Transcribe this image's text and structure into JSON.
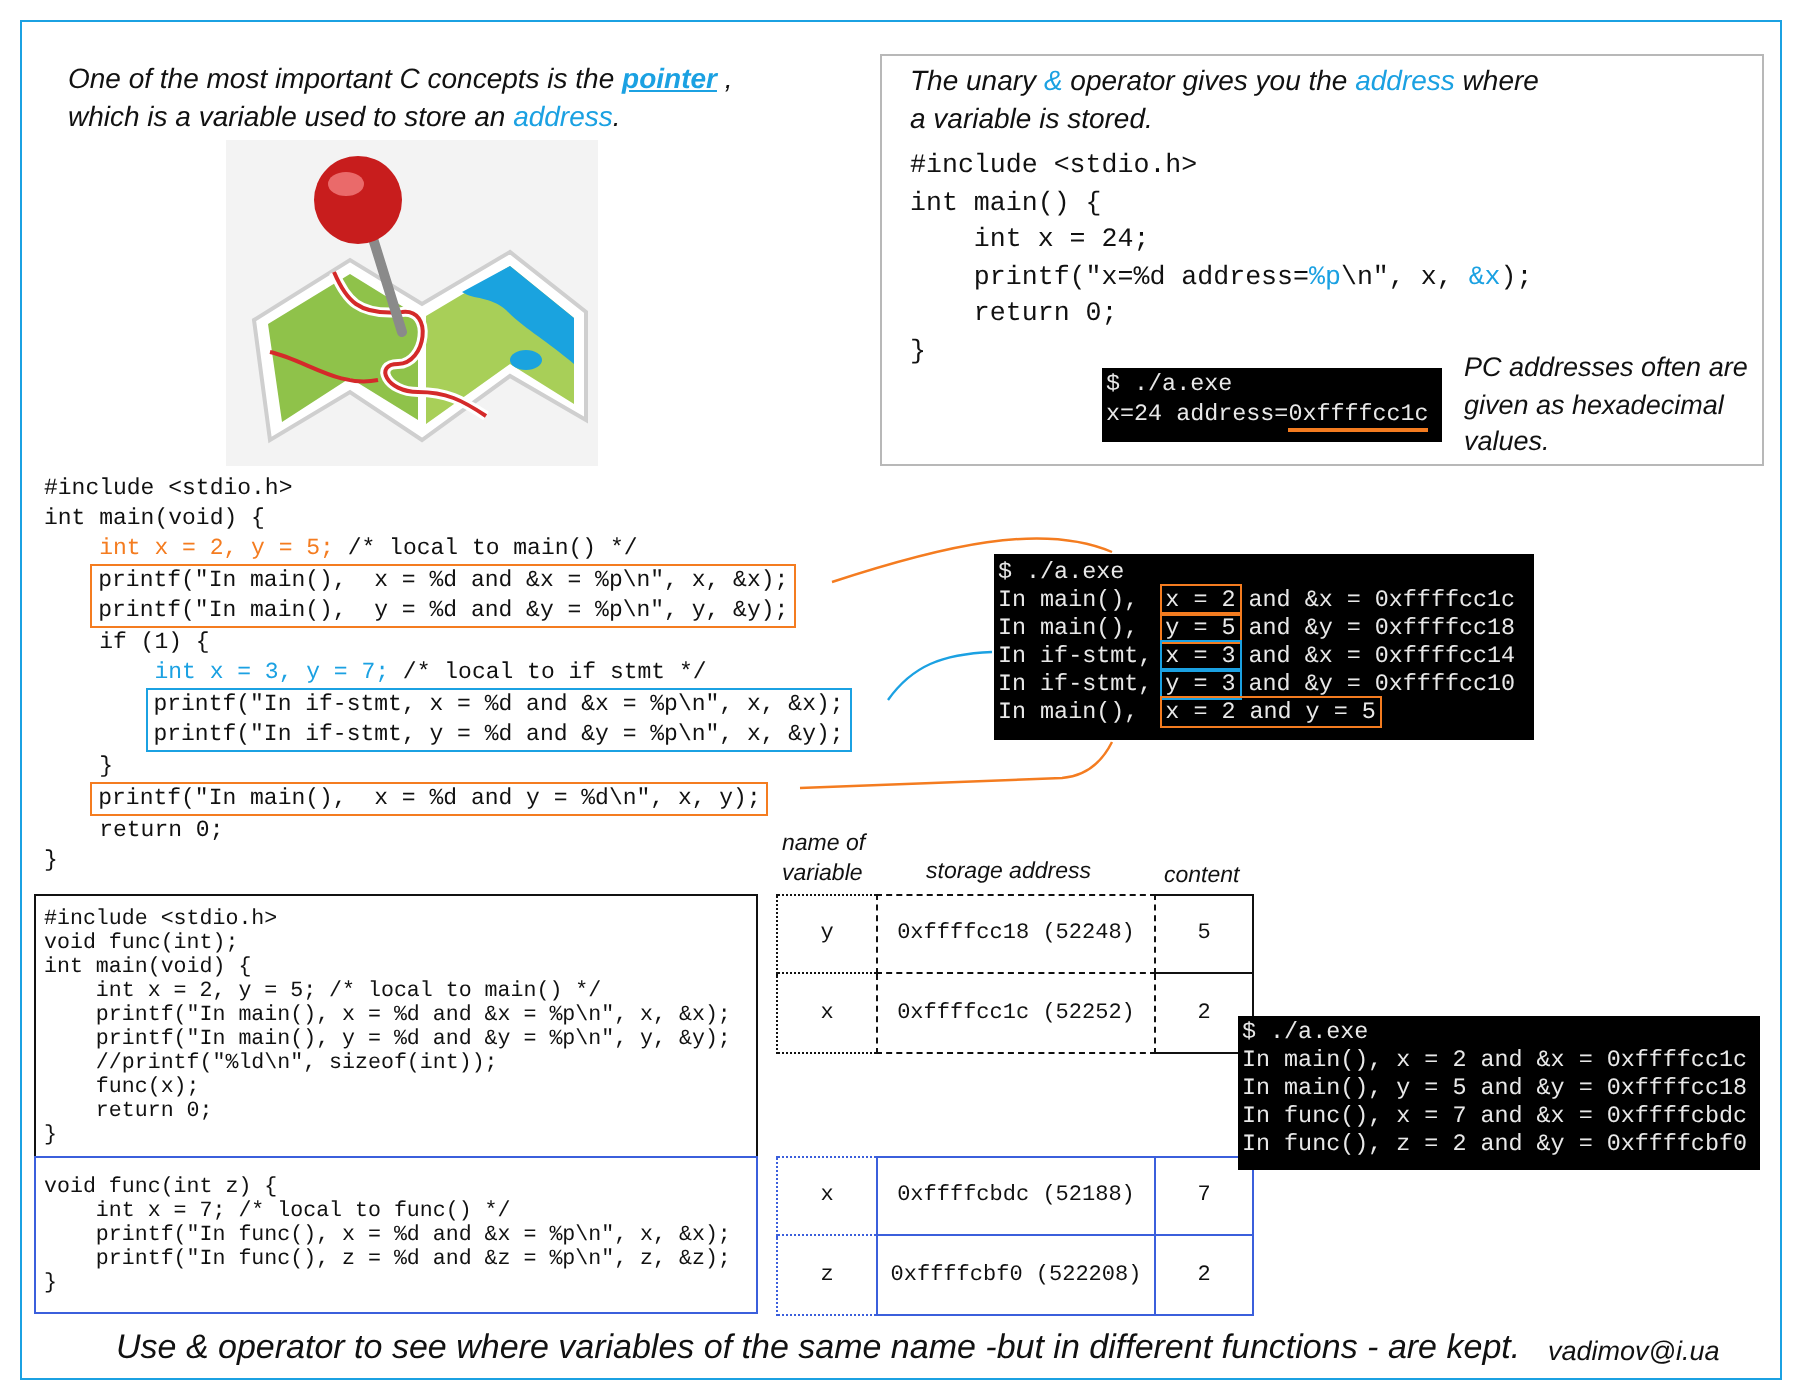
{
  "intro": {
    "segments": [
      {
        "text": "One of the most important C concepts is the ",
        "kind": "plain"
      },
      {
        "text": "pointer",
        "kind": "link"
      },
      {
        "text": " ,\nwhich is a variable used to store an ",
        "kind": "plain"
      },
      {
        "text": "address",
        "kind": "accent"
      },
      {
        "text": ".",
        "kind": "plain"
      }
    ]
  },
  "info": {
    "segments": [
      {
        "text": "The unary ",
        "kind": "plain"
      },
      {
        "text": "&",
        "kind": "accent"
      },
      {
        "text": " operator gives you the ",
        "kind": "plain"
      },
      {
        "text": "address",
        "kind": "accent"
      },
      {
        "text": " where\na variable is stored.",
        "kind": "plain"
      }
    ],
    "code": [
      "#include <stdio.h>",
      "int main() {",
      "    int x = 24;",
      {
        "segments": [
          {
            "text": "    printf(\"x=%d address=",
            "kind": "plain"
          },
          {
            "text": "%p",
            "kind": "accent"
          },
          {
            "text": "\\n\", x, ",
            "kind": "plain"
          },
          {
            "text": "&x",
            "kind": "accent"
          },
          {
            "text": ");",
            "kind": "plain"
          }
        ]
      },
      "    return 0;",
      "}"
    ],
    "terminal": [
      "$ ./a.exe",
      {
        "segments": [
          {
            "text": "x=24 address=",
            "kind": "plain"
          },
          {
            "text": "0xffffcc1c",
            "kind": "underline"
          }
        ]
      }
    ],
    "note": "PC addresses often are given as hexadecimal values."
  },
  "scope_demo": {
    "code_blocks": [
      {
        "kind": "plain",
        "lines": [
          "#include <stdio.h>",
          "int main(void) {",
          {
            "segments": [
              {
                "text": "    int x = 2, y = 5;",
                "kind": "warm"
              },
              {
                "text": " /* local to main() */",
                "kind": "plain"
              }
            ]
          }
        ]
      },
      {
        "kind": "framed",
        "color": "#f47c20",
        "lines": [
          "    printf(\"In main(),  x = %d and &x = %p\\n\", x, &x);",
          "    printf(\"In main(),  y = %d and &y = %p\\n\", y, &y);"
        ]
      },
      {
        "kind": "plain",
        "lines": [
          "    if (1) {",
          {
            "segments": [
              {
                "text": "        int x = 3, y = 7;",
                "kind": "accent"
              },
              {
                "text": " /* local to if stmt */",
                "kind": "plain"
              }
            ]
          }
        ]
      },
      {
        "kind": "framed",
        "color": "#1ba1e2",
        "lines": [
          "        printf(\"In if-stmt, x = %d and &x = %p\\n\", x, &x);",
          "        printf(\"In if-stmt, y = %d and &y = %p\\n\", x, &y);"
        ]
      },
      {
        "kind": "plain",
        "lines": [
          "    }"
        ]
      },
      {
        "kind": "framed",
        "color": "#f47c20",
        "lines": [
          "    printf(\"In main(),  x = %d and y = %d\\n\", x, y);"
        ]
      },
      {
        "kind": "plain",
        "lines": [
          "    return 0;",
          "}"
        ]
      }
    ],
    "terminal": [
      "$ ./a.exe",
      {
        "segments": [
          {
            "text": "In main(),  ",
            "kind": "plain"
          },
          {
            "text": "x = 2",
            "kind": "frame",
            "color": "#f47c20"
          },
          {
            "text": " and &x = 0xffffcc1c",
            "kind": "plain"
          }
        ]
      },
      {
        "segments": [
          {
            "text": "In main(),  ",
            "kind": "plain"
          },
          {
            "text": "y = 5",
            "kind": "frame",
            "color": "#f47c20"
          },
          {
            "text": " and &y = 0xffffcc18",
            "kind": "plain"
          }
        ]
      },
      {
        "segments": [
          {
            "text": "In if-stmt, ",
            "kind": "plain"
          },
          {
            "text": "x = 3",
            "kind": "frame",
            "color": "#1ba1e2"
          },
          {
            "text": " and &x = 0xffffcc14",
            "kind": "plain"
          }
        ]
      },
      {
        "segments": [
          {
            "text": "In if-stmt, ",
            "kind": "plain"
          },
          {
            "text": "y = 3",
            "kind": "frame",
            "color": "#1ba1e2"
          },
          {
            "text": " and &y = 0xffffcc10",
            "kind": "plain"
          }
        ]
      },
      {
        "segments": [
          {
            "text": "In main(),  ",
            "kind": "plain"
          },
          {
            "text": "x = 2 and y = 5",
            "kind": "frame",
            "color": "#f47c20"
          }
        ]
      }
    ]
  },
  "function_demo": {
    "code_panels": [
      {
        "kind": "main",
        "lines": [
          "#include <stdio.h>",
          "void func(int);",
          "int main(void) {",
          "    int x = 2, y = 5; /* local to main() */",
          "    printf(\"In main(), x = %d and &x = %p\\n\", x, &x);",
          "    printf(\"In main(), y = %d and &y = %p\\n\", y, &y);",
          "    //printf(\"%ld\\n\", sizeof(int));",
          "    func(x);",
          "    return 0;",
          "}"
        ]
      },
      {
        "kind": "func",
        "lines": [
          "void func(int z) {",
          "    int x = 7; /* local to func() */",
          "    printf(\"In func(), x = %d and &x = %p\\n\", x, &x);",
          "    printf(\"In func(), z = %d and &z = %p\\n\", z, &z);",
          "}"
        ]
      }
    ],
    "memory_table": {
      "headers": [
        "name of variable",
        "storage address",
        "content"
      ],
      "groups": [
        {
          "kind": "main",
          "rows": [
            {
              "name": "y",
              "address": "0xffffcc18 (52248)",
              "content": "5"
            },
            {
              "name": "x",
              "address": "0xffffcc1c (52252)",
              "content": "2"
            }
          ]
        },
        {
          "kind": "func",
          "rows": [
            {
              "name": "x",
              "address": "0xffffcbdc (52188)",
              "content": "7"
            },
            {
              "name": "z",
              "address": "0xffffcbf0 (522208)",
              "content": "2"
            }
          ]
        }
      ]
    },
    "terminal": [
      "$ ./a.exe",
      "In main(), x = 2 and &x = 0xffffcc1c",
      "In main(), y = 5 and &y = 0xffffcc18",
      "In func(), x = 7 and &x = 0xffffcbdc",
      "In func(), z = 2 and &y = 0xffffcbf0"
    ]
  },
  "footer": {
    "caption": "Use & operator to see where variables of the same name -but in different functions - are kept.",
    "author": "vadimov@i.ua"
  }
}
